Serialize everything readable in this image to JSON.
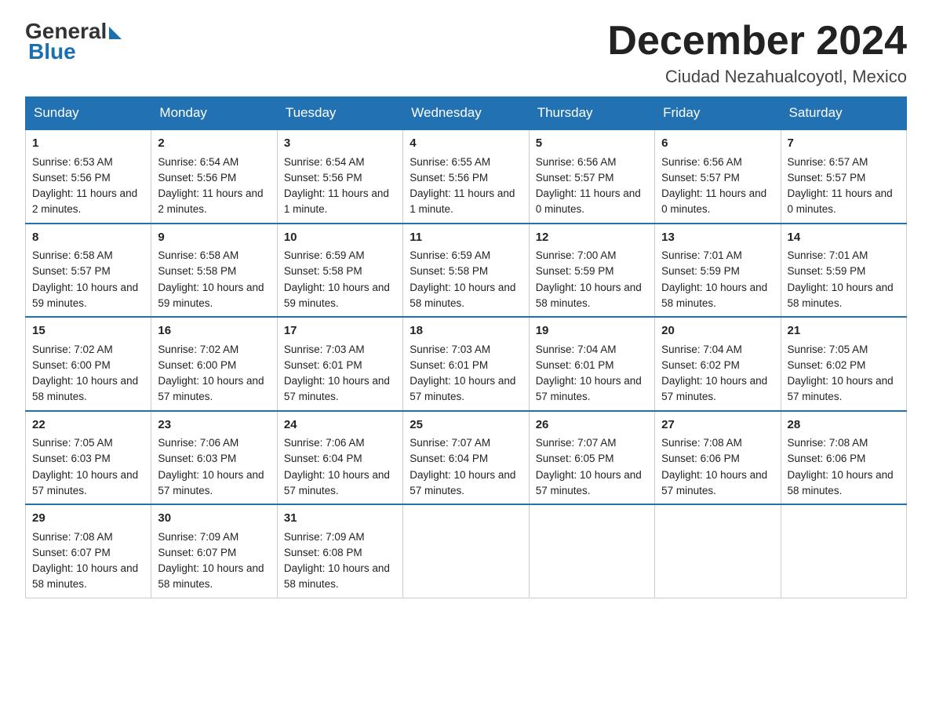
{
  "header": {
    "logo_general": "General",
    "logo_blue": "Blue",
    "month_title": "December 2024",
    "location": "Ciudad Nezahualcoyotl, Mexico"
  },
  "weekdays": [
    "Sunday",
    "Monday",
    "Tuesday",
    "Wednesday",
    "Thursday",
    "Friday",
    "Saturday"
  ],
  "weeks": [
    [
      {
        "day": "1",
        "sunrise": "Sunrise: 6:53 AM",
        "sunset": "Sunset: 5:56 PM",
        "daylight": "Daylight: 11 hours and 2 minutes."
      },
      {
        "day": "2",
        "sunrise": "Sunrise: 6:54 AM",
        "sunset": "Sunset: 5:56 PM",
        "daylight": "Daylight: 11 hours and 2 minutes."
      },
      {
        "day": "3",
        "sunrise": "Sunrise: 6:54 AM",
        "sunset": "Sunset: 5:56 PM",
        "daylight": "Daylight: 11 hours and 1 minute."
      },
      {
        "day": "4",
        "sunrise": "Sunrise: 6:55 AM",
        "sunset": "Sunset: 5:56 PM",
        "daylight": "Daylight: 11 hours and 1 minute."
      },
      {
        "day": "5",
        "sunrise": "Sunrise: 6:56 AM",
        "sunset": "Sunset: 5:57 PM",
        "daylight": "Daylight: 11 hours and 0 minutes."
      },
      {
        "day": "6",
        "sunrise": "Sunrise: 6:56 AM",
        "sunset": "Sunset: 5:57 PM",
        "daylight": "Daylight: 11 hours and 0 minutes."
      },
      {
        "day": "7",
        "sunrise": "Sunrise: 6:57 AM",
        "sunset": "Sunset: 5:57 PM",
        "daylight": "Daylight: 11 hours and 0 minutes."
      }
    ],
    [
      {
        "day": "8",
        "sunrise": "Sunrise: 6:58 AM",
        "sunset": "Sunset: 5:57 PM",
        "daylight": "Daylight: 10 hours and 59 minutes."
      },
      {
        "day": "9",
        "sunrise": "Sunrise: 6:58 AM",
        "sunset": "Sunset: 5:58 PM",
        "daylight": "Daylight: 10 hours and 59 minutes."
      },
      {
        "day": "10",
        "sunrise": "Sunrise: 6:59 AM",
        "sunset": "Sunset: 5:58 PM",
        "daylight": "Daylight: 10 hours and 59 minutes."
      },
      {
        "day": "11",
        "sunrise": "Sunrise: 6:59 AM",
        "sunset": "Sunset: 5:58 PM",
        "daylight": "Daylight: 10 hours and 58 minutes."
      },
      {
        "day": "12",
        "sunrise": "Sunrise: 7:00 AM",
        "sunset": "Sunset: 5:59 PM",
        "daylight": "Daylight: 10 hours and 58 minutes."
      },
      {
        "day": "13",
        "sunrise": "Sunrise: 7:01 AM",
        "sunset": "Sunset: 5:59 PM",
        "daylight": "Daylight: 10 hours and 58 minutes."
      },
      {
        "day": "14",
        "sunrise": "Sunrise: 7:01 AM",
        "sunset": "Sunset: 5:59 PM",
        "daylight": "Daylight: 10 hours and 58 minutes."
      }
    ],
    [
      {
        "day": "15",
        "sunrise": "Sunrise: 7:02 AM",
        "sunset": "Sunset: 6:00 PM",
        "daylight": "Daylight: 10 hours and 58 minutes."
      },
      {
        "day": "16",
        "sunrise": "Sunrise: 7:02 AM",
        "sunset": "Sunset: 6:00 PM",
        "daylight": "Daylight: 10 hours and 57 minutes."
      },
      {
        "day": "17",
        "sunrise": "Sunrise: 7:03 AM",
        "sunset": "Sunset: 6:01 PM",
        "daylight": "Daylight: 10 hours and 57 minutes."
      },
      {
        "day": "18",
        "sunrise": "Sunrise: 7:03 AM",
        "sunset": "Sunset: 6:01 PM",
        "daylight": "Daylight: 10 hours and 57 minutes."
      },
      {
        "day": "19",
        "sunrise": "Sunrise: 7:04 AM",
        "sunset": "Sunset: 6:01 PM",
        "daylight": "Daylight: 10 hours and 57 minutes."
      },
      {
        "day": "20",
        "sunrise": "Sunrise: 7:04 AM",
        "sunset": "Sunset: 6:02 PM",
        "daylight": "Daylight: 10 hours and 57 minutes."
      },
      {
        "day": "21",
        "sunrise": "Sunrise: 7:05 AM",
        "sunset": "Sunset: 6:02 PM",
        "daylight": "Daylight: 10 hours and 57 minutes."
      }
    ],
    [
      {
        "day": "22",
        "sunrise": "Sunrise: 7:05 AM",
        "sunset": "Sunset: 6:03 PM",
        "daylight": "Daylight: 10 hours and 57 minutes."
      },
      {
        "day": "23",
        "sunrise": "Sunrise: 7:06 AM",
        "sunset": "Sunset: 6:03 PM",
        "daylight": "Daylight: 10 hours and 57 minutes."
      },
      {
        "day": "24",
        "sunrise": "Sunrise: 7:06 AM",
        "sunset": "Sunset: 6:04 PM",
        "daylight": "Daylight: 10 hours and 57 minutes."
      },
      {
        "day": "25",
        "sunrise": "Sunrise: 7:07 AM",
        "sunset": "Sunset: 6:04 PM",
        "daylight": "Daylight: 10 hours and 57 minutes."
      },
      {
        "day": "26",
        "sunrise": "Sunrise: 7:07 AM",
        "sunset": "Sunset: 6:05 PM",
        "daylight": "Daylight: 10 hours and 57 minutes."
      },
      {
        "day": "27",
        "sunrise": "Sunrise: 7:08 AM",
        "sunset": "Sunset: 6:06 PM",
        "daylight": "Daylight: 10 hours and 57 minutes."
      },
      {
        "day": "28",
        "sunrise": "Sunrise: 7:08 AM",
        "sunset": "Sunset: 6:06 PM",
        "daylight": "Daylight: 10 hours and 58 minutes."
      }
    ],
    [
      {
        "day": "29",
        "sunrise": "Sunrise: 7:08 AM",
        "sunset": "Sunset: 6:07 PM",
        "daylight": "Daylight: 10 hours and 58 minutes."
      },
      {
        "day": "30",
        "sunrise": "Sunrise: 7:09 AM",
        "sunset": "Sunset: 6:07 PM",
        "daylight": "Daylight: 10 hours and 58 minutes."
      },
      {
        "day": "31",
        "sunrise": "Sunrise: 7:09 AM",
        "sunset": "Sunset: 6:08 PM",
        "daylight": "Daylight: 10 hours and 58 minutes."
      },
      null,
      null,
      null,
      null
    ]
  ]
}
